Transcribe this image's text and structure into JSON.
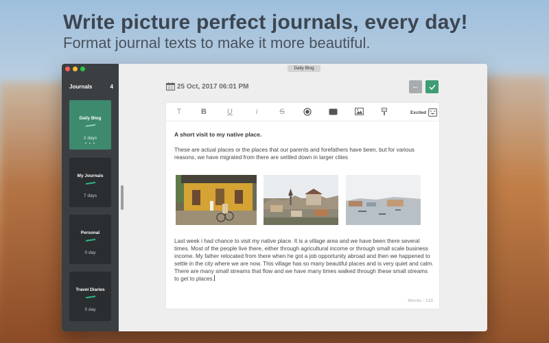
{
  "hero": {
    "title": "Write picture perfect journals, every day!",
    "subtitle": "Format journal texts to make it more beautiful."
  },
  "window": {
    "title": "Daily Blog"
  },
  "sidebar": {
    "header_label": "Journals",
    "header_count": "4",
    "journals": [
      {
        "name": "Daily Blog",
        "count": "2 days",
        "active": true,
        "dots": "• • •"
      },
      {
        "name": "My Journals",
        "count": "7 days",
        "active": false
      },
      {
        "name": "Personal",
        "count": "0 day",
        "active": false
      },
      {
        "name": "Travel Diaries",
        "count": "0 day",
        "active": false
      }
    ]
  },
  "entry": {
    "date": "25 Oct, 2017 06:01 PM",
    "mood": "Excited",
    "title": "A short visit to my native place.",
    "paragraph1": "These are actual places or the places that our parents and forefathers have been, but for various reasons, we have migrated from there are settled down in larger cities",
    "paragraph2": "Last week i had chance to visit my native place. It is a village area and we have been there several times. Most of the people live there, either through agricultural income or through small scale business income. My father relocated from there when he got a job opportunity abroad and then we happened to settle in the city where we are now. This village has so many beautiful places and is very quiet and calm. There are many small streams that flow and we have many times walked through these small streams to get to places.",
    "word_count": "Words : 133"
  },
  "toolbar": {
    "text_glyph": "T",
    "bold_glyph": "B",
    "underline_glyph": "U",
    "italic_glyph": "i",
    "strike_glyph": "S"
  },
  "colors": {
    "accent": "#3e9d73",
    "sidebar_bg": "#3b3f42",
    "active_card": "#3e8a6f"
  }
}
